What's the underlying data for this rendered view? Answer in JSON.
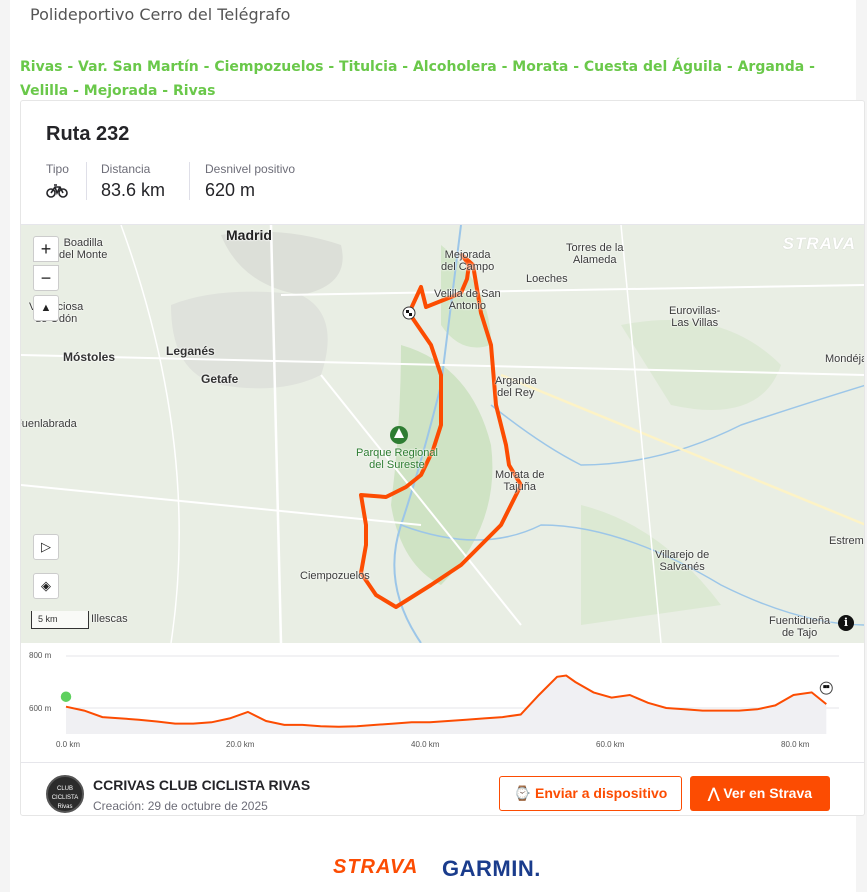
{
  "header": {
    "venue": "Polideportivo Cerro del Telégrafo",
    "route_description": "Rivas - Var. San Martín - Ciempozuelos - Titulcia - Alcoholera - Morata - Cuesta del Águila - Arganda - Velilla - Mejorada - Rivas"
  },
  "card": {
    "title": "Ruta 232",
    "stats": [
      {
        "label": "Tipo",
        "icon": "bike-icon"
      },
      {
        "label": "Distancia",
        "value": "83.6 km"
      },
      {
        "label": "Desnivel positivo",
        "value": "620 m"
      }
    ]
  },
  "map": {
    "watermark": "STRAVA",
    "zoom_in": "+",
    "zoom_out": "−",
    "scale": "5 km",
    "info": "i",
    "labels": [
      {
        "text": "Madrid"
      },
      {
        "text": "Boadilla\ndel Monte"
      },
      {
        "text": "Villaviciosa\nde Odón"
      },
      {
        "text": "Móstoles"
      },
      {
        "text": "Leganés"
      },
      {
        "text": "Getafe"
      },
      {
        "text": "Fuenlabrada"
      },
      {
        "text": "Mejorada\ndel Campo"
      },
      {
        "text": "Velilla de San\nAntonio"
      },
      {
        "text": "Torres de la\nAlameda"
      },
      {
        "text": "Loeches"
      },
      {
        "text": "Eurovillas-\nLas Villas"
      },
      {
        "text": "Mondéjar"
      },
      {
        "text": "Arganda\ndel Rey"
      },
      {
        "text": "Parque Regional\ndel Sureste"
      },
      {
        "text": "Morata de\nTajuña"
      },
      {
        "text": "Ciempozuelos"
      },
      {
        "text": "Villarejo de\nSalvanés"
      },
      {
        "text": "Estremera"
      },
      {
        "text": "Illescas"
      },
      {
        "text": "Fuentidueña\nde Tajo"
      }
    ],
    "route_color": "#fc4c02"
  },
  "elevation": {
    "y_ticks": [
      "800 m",
      "600 m"
    ],
    "x_ticks": [
      "0.0 km",
      "20.0 km",
      "40.0 km",
      "60.0 km",
      "80.0 km"
    ],
    "profile_km": [
      0,
      2,
      4,
      6,
      8,
      10,
      12,
      14,
      16,
      18,
      20,
      22,
      24,
      26,
      28,
      30,
      32,
      34,
      36,
      38,
      40,
      42,
      44,
      46,
      48,
      50,
      52,
      54,
      55,
      56,
      58,
      60,
      62,
      64,
      66,
      68,
      70,
      72,
      74,
      76,
      78,
      80,
      82,
      83.6
    ],
    "profile_m": [
      605,
      590,
      565,
      560,
      555,
      548,
      540,
      540,
      545,
      560,
      585,
      550,
      535,
      535,
      530,
      528,
      530,
      535,
      540,
      545,
      545,
      550,
      555,
      560,
      565,
      575,
      650,
      720,
      725,
      700,
      660,
      640,
      650,
      620,
      600,
      595,
      590,
      590,
      590,
      595,
      610,
      650,
      660,
      615
    ],
    "line_color": "#fc4c02"
  },
  "owner": {
    "logo_text": "CLUB CICLISTA Rivas",
    "name": "CCRIVAS CLUB CICLISTA RIVAS",
    "created": "Creación: 29 de octubre de 2025"
  },
  "actions": {
    "send_device": "Enviar a dispositivo",
    "view_strava": "Ver en Strava"
  },
  "brands": {
    "strava": "STRAVA",
    "garmin": "GARMIN."
  },
  "colors": {
    "accent": "#fc4c02",
    "route_text": "#6ac84a",
    "garmin": "#1a3c8c"
  }
}
